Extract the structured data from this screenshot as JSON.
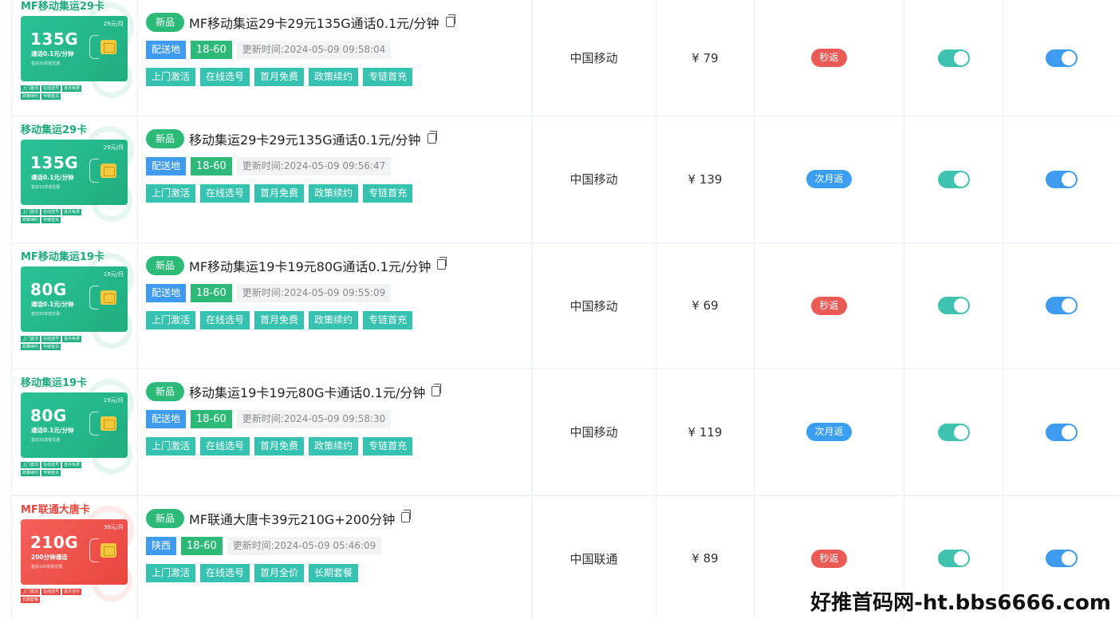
{
  "rows": [
    {
      "card": {
        "theme": "green",
        "brand": "MF移动集运29卡",
        "price": "29元/月",
        "gb": "135G",
        "calls": "通话0.1元/分钟",
        "note": "首充50享受优惠",
        "mini": [
          "上门激活",
          "在线选号",
          "首月免费",
          "政策续约",
          "专链首充"
        ]
      },
      "badge": "新品",
      "title": "MF移动集运29卡29元135G通话0.1元/分钟",
      "region": "配送地",
      "age": "18-60",
      "updated": "更新时间:2024-05-09 09:58:04",
      "features": [
        "上门激活",
        "在线选号",
        "首月免费",
        "政策续约",
        "专链首充"
      ],
      "carrier": "中国移动",
      "price": "¥ 79",
      "rebate": "秒返",
      "rebate_color": "red"
    },
    {
      "card": {
        "theme": "green",
        "brand": "移动集运29卡",
        "price": "29元/月",
        "gb": "135G",
        "calls": "通话0.1元/分钟",
        "note": "首充50享受优惠",
        "mini": [
          "上门激活",
          "在线选号",
          "首月免费",
          "政策续约",
          "专链首充"
        ]
      },
      "badge": "新品",
      "title": "移动集运29卡29元135G通话0.1元/分钟",
      "region": "配送地",
      "age": "18-60",
      "updated": "更新时间:2024-05-09 09:56:47",
      "features": [
        "上门激活",
        "在线选号",
        "首月免费",
        "政策续约",
        "专链首充"
      ],
      "carrier": "中国移动",
      "price": "¥ 139",
      "rebate": "次月返",
      "rebate_color": "blue"
    },
    {
      "card": {
        "theme": "green",
        "brand": "MF移动集运19卡",
        "price": "19元/月",
        "gb": "80G",
        "calls": "通话0.1元/分钟",
        "note": "首充50享受优惠",
        "mini": [
          "上门激活",
          "在线选号",
          "首月免费",
          "政策续约",
          "专链首充"
        ]
      },
      "badge": "新品",
      "title": "MF移动集运19卡19元80G通话0.1元/分钟",
      "region": "配送地",
      "age": "18-60",
      "updated": "更新时间:2024-05-09 09:55:09",
      "features": [
        "上门激活",
        "在线选号",
        "首月免费",
        "政策续约",
        "专链首充"
      ],
      "carrier": "中国移动",
      "price": "¥ 69",
      "rebate": "秒返",
      "rebate_color": "red"
    },
    {
      "card": {
        "theme": "green",
        "brand": "移动集运19卡",
        "price": "19元/月",
        "gb": "80G",
        "calls": "通话0.1元/分钟",
        "note": "首充50享受优惠",
        "mini": [
          "上门激活",
          "在线选号",
          "首月免费",
          "政策续约",
          "专链首充"
        ]
      },
      "badge": "新品",
      "title": "移动集运19卡19元80G卡通话0.1元/分钟",
      "region": "配送地",
      "age": "18-60",
      "updated": "更新时间:2024-05-09 09:58:30",
      "features": [
        "上门激活",
        "在线选号",
        "首月免费",
        "政策续约",
        "专链首充"
      ],
      "carrier": "中国移动",
      "price": "¥ 119",
      "rebate": "次月返",
      "rebate_color": "blue"
    },
    {
      "card": {
        "theme": "red",
        "brand": "MF联通大唐卡",
        "price": "39元/月",
        "gb": "210G",
        "calls": "200分钟通话",
        "note": "首充100享受优惠",
        "mini": [
          "上门激活",
          "在线选号",
          "首月全价",
          "长期套餐"
        ]
      },
      "badge": "新品",
      "title": "MF联通大唐卡39元210G+200分钟",
      "region": "陕西",
      "age": "18-60",
      "updated": "更新时间:2024-05-09 05:46:09",
      "features": [
        "上门激活",
        "在线选号",
        "首月全价",
        "长期套餐"
      ],
      "carrier": "中国联通",
      "price": "¥ 89",
      "rebate": "秒返",
      "rebate_color": "red"
    }
  ],
  "watermark": "好推首码网-ht.bbs6666.com"
}
